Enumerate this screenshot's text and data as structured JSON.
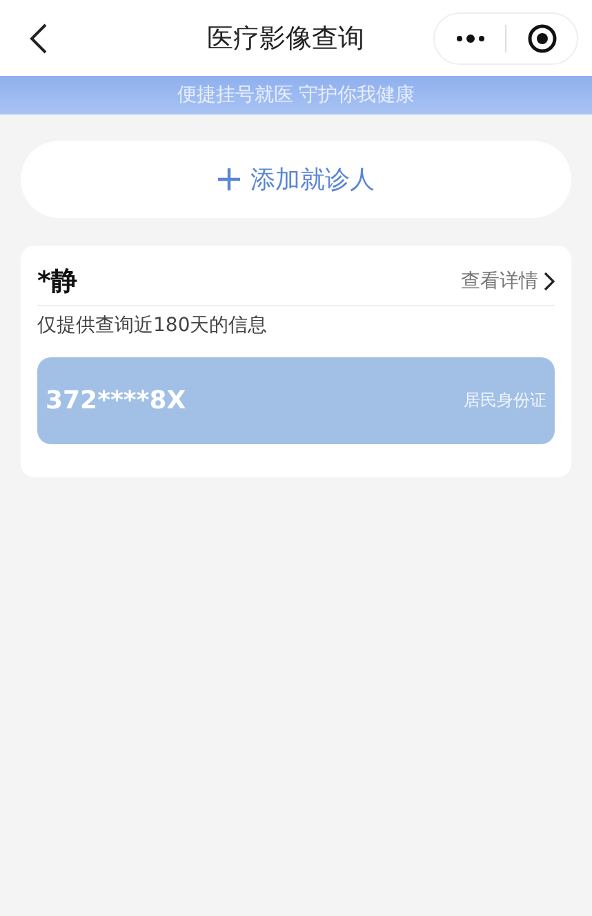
{
  "window": {
    "title": "医疗影像查询"
  },
  "banner": "便捷挂号就医 守护你我健康",
  "add_button": {
    "label": "添加就诊人"
  },
  "patients": [
    {
      "name": "*静",
      "details_link": "查看详情",
      "note": "仅提供查询近180天的信息",
      "id_number": "372****8X",
      "id_type": "居民身份证"
    }
  ]
}
